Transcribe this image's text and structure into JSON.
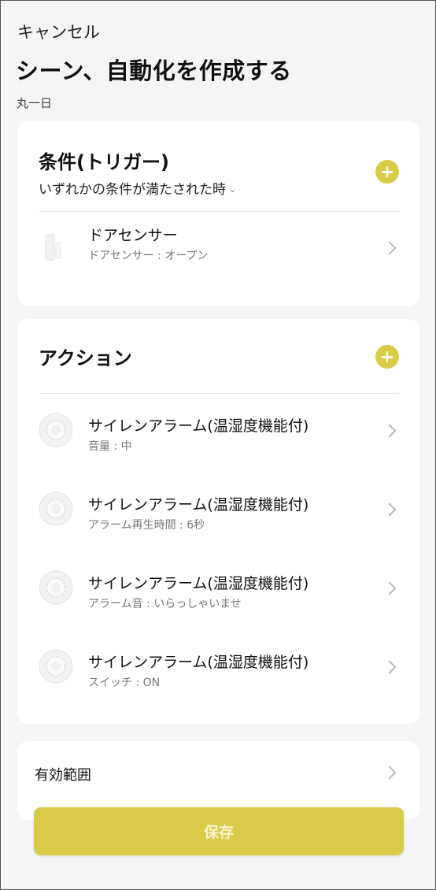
{
  "header": {
    "cancel_label": "キャンセル",
    "title": "シーン、自動化を作成する",
    "subtitle": "丸一日"
  },
  "conditions": {
    "title": "条件(トリガー)",
    "mode": "いずれかの条件が満たされた時",
    "items": [
      {
        "name": "ドアセンサー",
        "detail": "ドアセンサー : オープン",
        "icon": "door-sensor-icon"
      }
    ]
  },
  "actions": {
    "title": "アクション",
    "items": [
      {
        "name": "サイレンアラーム(温湿度機能付)",
        "detail": "音量 : 中",
        "icon": "siren-alarm-icon"
      },
      {
        "name": "サイレンアラーム(温湿度機能付)",
        "detail": "アラーム再生時間 : 6秒",
        "icon": "siren-alarm-icon"
      },
      {
        "name": "サイレンアラーム(温湿度機能付)",
        "detail": "アラーム音 : いらっしゃいませ",
        "icon": "siren-alarm-icon"
      },
      {
        "name": "サイレンアラーム(温湿度機能付)",
        "detail": "スイッチ : ON",
        "icon": "siren-alarm-icon"
      }
    ]
  },
  "scope": {
    "label": "有効範囲"
  },
  "footer": {
    "save_label": "保存"
  },
  "colors": {
    "accent": "#d8cb48",
    "background": "#f5f5f5",
    "card": "#ffffff"
  }
}
